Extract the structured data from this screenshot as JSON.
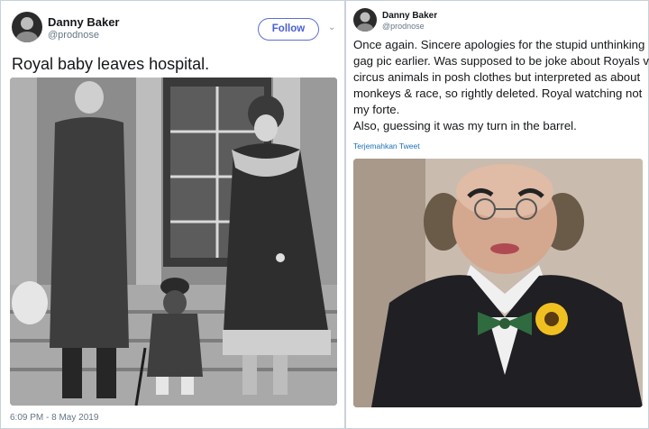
{
  "left_tweet": {
    "author_name": "Danny Baker",
    "author_handle": "@prodnose",
    "follow_label": "Follow",
    "chevron": "⌄",
    "text": "Royal baby leaves hospital.",
    "timestamp": "6:09 PM - 8 May 2019",
    "avatar_icon": "profile-avatar",
    "accent_color": "#4a5fd0"
  },
  "right_tweet": {
    "author_name": "Danny Baker",
    "author_handle": "@prodnose",
    "text_lines": [
      "Once again. Sincere apologies for the stupid unthinking",
      "gag pic earlier. Was supposed to be joke about Royals vs",
      "circus animals in posh clothes but interpreted as about",
      "monkeys & race, so rightly deleted. Royal watching not",
      "my forte.",
      "Also, guessing it was my turn in the barrel."
    ],
    "translate_link": "Terjemahkan Tweet",
    "link_color": "#1b6fb8"
  }
}
